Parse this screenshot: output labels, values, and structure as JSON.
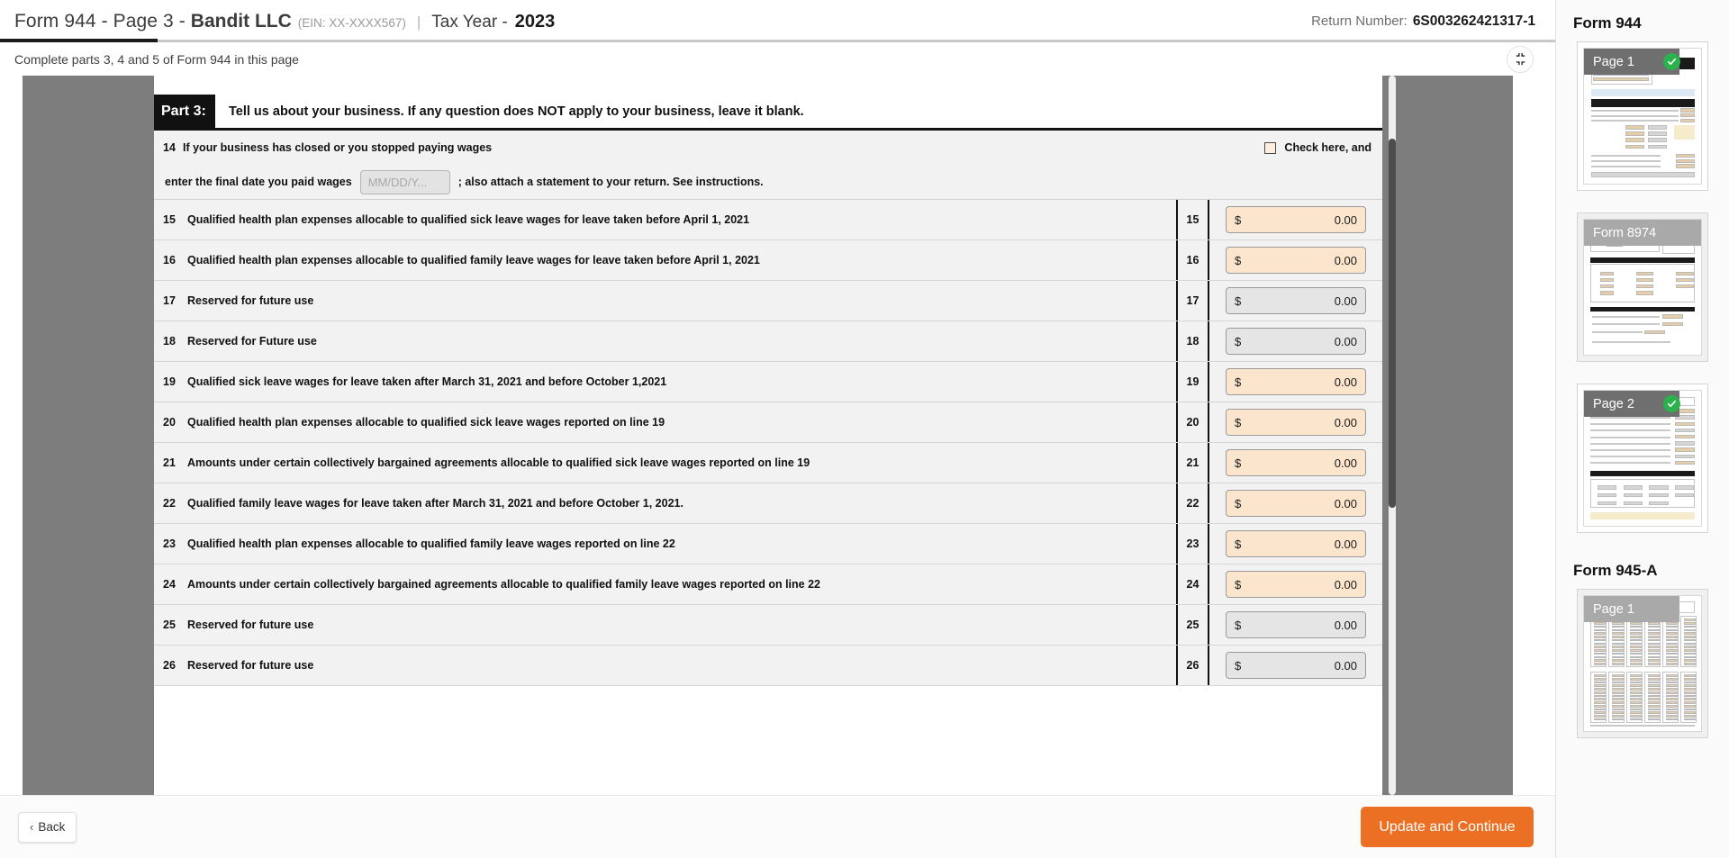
{
  "header": {
    "form_title": "Form 944 - Page 3",
    "dash": "-",
    "company": "Bandit LLC",
    "ein": "(EIN: XX-XXXX567)",
    "separator": "|",
    "tax_year_label": "Tax Year -",
    "tax_year_value": "2023",
    "return_number_label": "Return Number:",
    "return_number_value": "6S003262421317-1"
  },
  "subheader": {
    "instruction": "Complete parts 3, 4 and 5 of Form 944 in this page",
    "collapse_icon": "compress-arrows-icon"
  },
  "part": {
    "label": "Part 3:",
    "description": "Tell us about your business. If any question does NOT apply to your business, leave it blank."
  },
  "line14": {
    "number": "14",
    "text": "If your business has closed or you stopped paying wages",
    "checkbox_label": "Check here, and",
    "checkbox_checked": false,
    "lead_text": "enter the final date you paid wages",
    "date_value": "",
    "date_placeholder": "MM/DD/Y...",
    "tail_text": "; also attach a statement to your return. See instructions."
  },
  "lines": [
    {
      "number": "15",
      "text": "Qualified health plan expenses allocable to qualified sick leave wages for leave taken before April 1, 2021",
      "lineno": "15",
      "currency": "$",
      "value": "0.00",
      "state": "editable"
    },
    {
      "number": "16",
      "text": "Qualified health plan expenses allocable to qualified family leave wages for leave taken before April 1, 2021",
      "lineno": "16",
      "currency": "$",
      "value": "0.00",
      "state": "editable"
    },
    {
      "number": "17",
      "text": "Reserved for future use",
      "lineno": "17",
      "currency": "$",
      "value": "0.00",
      "state": "readonly"
    },
    {
      "number": "18",
      "text": "Reserved for Future use",
      "lineno": "18",
      "currency": "$",
      "value": "0.00",
      "state": "readonly"
    },
    {
      "number": "19",
      "text": "Qualified sick leave wages for leave taken after March 31, 2021 and before October 1,2021",
      "lineno": "19",
      "currency": "$",
      "value": "0.00",
      "state": "editable"
    },
    {
      "number": "20",
      "text": "Qualified health plan expenses allocable to qualified sick leave wages reported on line 19",
      "lineno": "20",
      "currency": "$",
      "value": "0.00",
      "state": "editable"
    },
    {
      "number": "21",
      "text": "Amounts under certain collectively bargained agreements allocable to qualified sick leave wages reported on line 19",
      "lineno": "21",
      "currency": "$",
      "value": "0.00",
      "state": "editable"
    },
    {
      "number": "22",
      "text": "Qualified family leave wages for leave taken after March 31, 2021 and before October 1, 2021.",
      "lineno": "22",
      "currency": "$",
      "value": "0.00",
      "state": "editable"
    },
    {
      "number": "23",
      "text": "Qualified health plan expenses allocable to qualified family leave wages reported on line 22",
      "lineno": "23",
      "currency": "$",
      "value": "0.00",
      "state": "editable"
    },
    {
      "number": "24",
      "text": "Amounts under certain collectively bargained agreements allocable to qualified family leave wages reported on line 22",
      "lineno": "24",
      "currency": "$",
      "value": "0.00",
      "state": "editable"
    },
    {
      "number": "25",
      "text": "Reserved for future use",
      "lineno": "25",
      "currency": "$",
      "value": "0.00",
      "state": "readonly"
    },
    {
      "number": "26",
      "text": "Reserved for future use",
      "lineno": "26",
      "currency": "$",
      "value": "0.00",
      "state": "readonly"
    }
  ],
  "footer": {
    "back_label": "Back",
    "back_chevron": "chevron-left-icon",
    "primary_label": "Update and Continue"
  },
  "sidebar": {
    "groups": [
      {
        "title": "Form 944",
        "thumbs": [
          {
            "badge": "Page 1",
            "completed": true,
            "shaded": false
          },
          {
            "badge": "Form 8974",
            "completed": false,
            "shaded": true
          },
          {
            "badge": "Page 2",
            "completed": true,
            "shaded": false
          }
        ]
      },
      {
        "title": "Form 945-A",
        "thumbs": [
          {
            "badge": "Page 1",
            "completed": false,
            "shaded": true
          }
        ]
      }
    ]
  },
  "colors": {
    "accent_orange": "#ec7024",
    "editable_field": "#fbe5cc",
    "readonly_field": "#e5e5e5",
    "check_green": "#2bb24c",
    "gutter_grey": "#7d7d7d"
  }
}
